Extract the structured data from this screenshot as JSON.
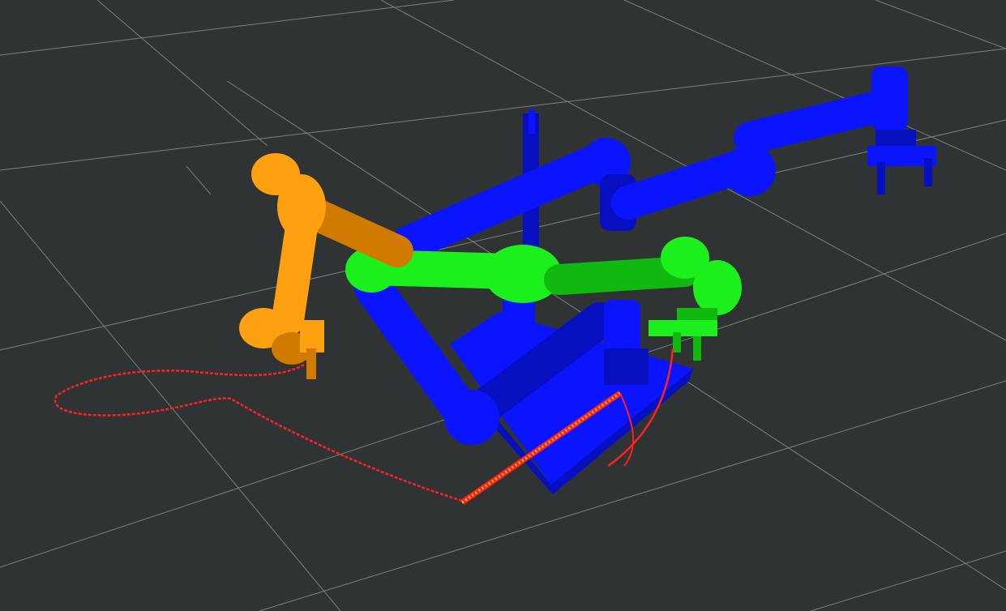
{
  "scene": {
    "background_color": "#2f3334",
    "grid_color": "#8a9090",
    "colors": {
      "background_robot": "#0a14ff",
      "background_robot_shade": "#0610c0",
      "mount_plate": "#0a14ff",
      "green_robot": "#1cf01c",
      "green_robot_shade": "#10b810",
      "orange_robot": "#ffa010",
      "orange_robot_shade": "#d07a00",
      "trajectory_line": "#ff2020",
      "trajectory_marker": "#ffd020"
    },
    "objects": [
      "grid-floor",
      "mount-plate",
      "center-column",
      "blue-robot-arm",
      "blue-gripper",
      "blue-base-arm",
      "green-robot-arm",
      "green-gripper",
      "orange-robot-arm",
      "orange-gripper",
      "trajectory-paths"
    ]
  }
}
